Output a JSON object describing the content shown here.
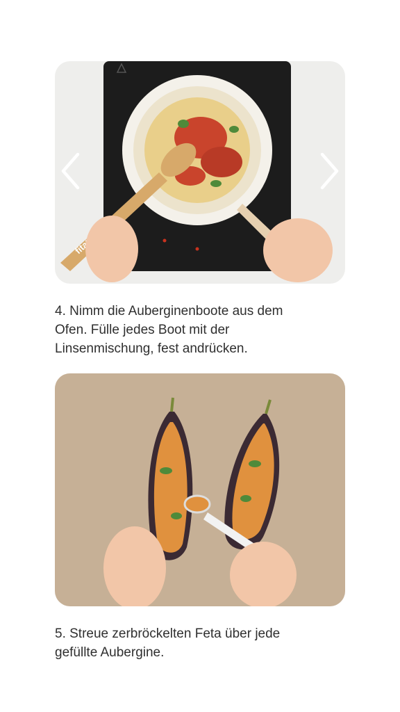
{
  "carousel": {
    "prev_icon": "chevron-left-icon",
    "next_icon": "chevron-right-icon"
  },
  "steps": [
    {
      "image_label": "",
      "spoon_brand": "fitatu",
      "text": "4. Nimm die Auberginenboote aus dem\nOfen. Fülle jedes Boot mit der\nLinsenmischung, fest andrücken."
    },
    {
      "image_label": "",
      "text": "5. Streue zerbröckelten Feta über jede\ngefüllte Aubergine."
    }
  ],
  "colors": {
    "accent_red": "#c9442c",
    "herb_green": "#4f8a3a",
    "parchment": "#c9b49a",
    "stovetop": "#1c1c1c"
  }
}
